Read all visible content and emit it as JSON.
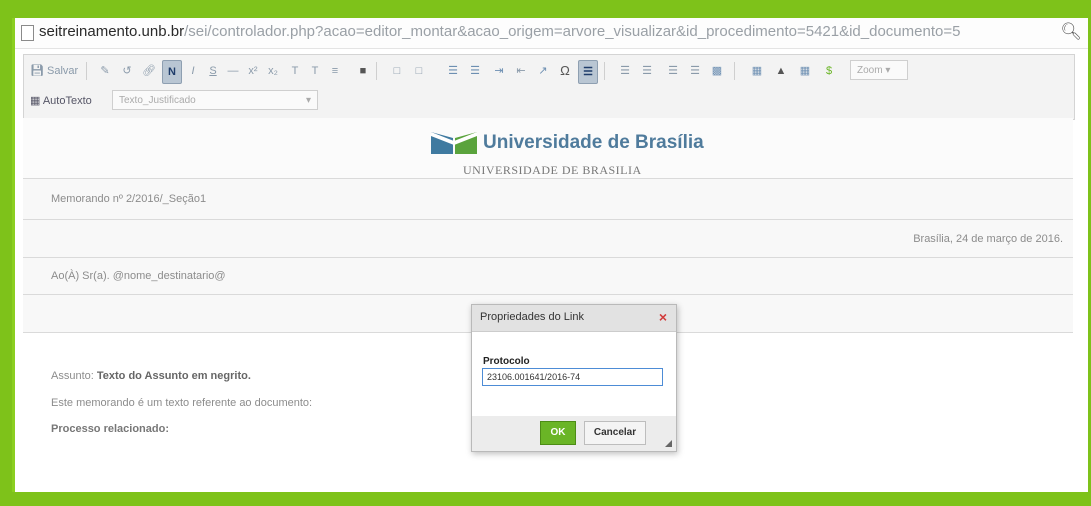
{
  "address_bar": {
    "host": "seitreinamento.unb.br",
    "path": "/sei/controlador.php?acao=editor_montar&acao_origem=arvore_visualizar&id_procedimento=5421&id_documento=5"
  },
  "toolbar": {
    "save_label": "Salvar",
    "bold_label": "N",
    "italic_label": "I",
    "underline_label": "S",
    "omega_label": "Ω",
    "zoom_label": "Zoom",
    "autotext_label": "AutoTexto",
    "style_select_value": "Texto_Justificado"
  },
  "document": {
    "logo_title": "Universidade de Brasília",
    "logo_subtitle": "UNIVERSIDADE DE BRASILIA",
    "memo_header": "Memorando nº 2/2016/_Seção1",
    "date_line": "Brasília, 24 de março de 2016.",
    "recipient": "Ao(À) Sr(a). @nome_destinatario@",
    "subject_label": "Assunto:",
    "subject_text": "Texto do Assunto em negrito.",
    "body_text": "Este memorando é um texto referente ao documento:",
    "related_process": "Processo relacionado:"
  },
  "dialog": {
    "title": "Propriedades do Link",
    "field_label": "Protocolo",
    "field_value": "23106.001641/2016-74",
    "ok_label": "OK",
    "cancel_label": "Cancelar"
  },
  "colors": {
    "frame_green": "#7ec21a",
    "ok_green": "#6ab526",
    "close_red": "#d23a3a",
    "logo_blue": "#4f7b9c"
  }
}
